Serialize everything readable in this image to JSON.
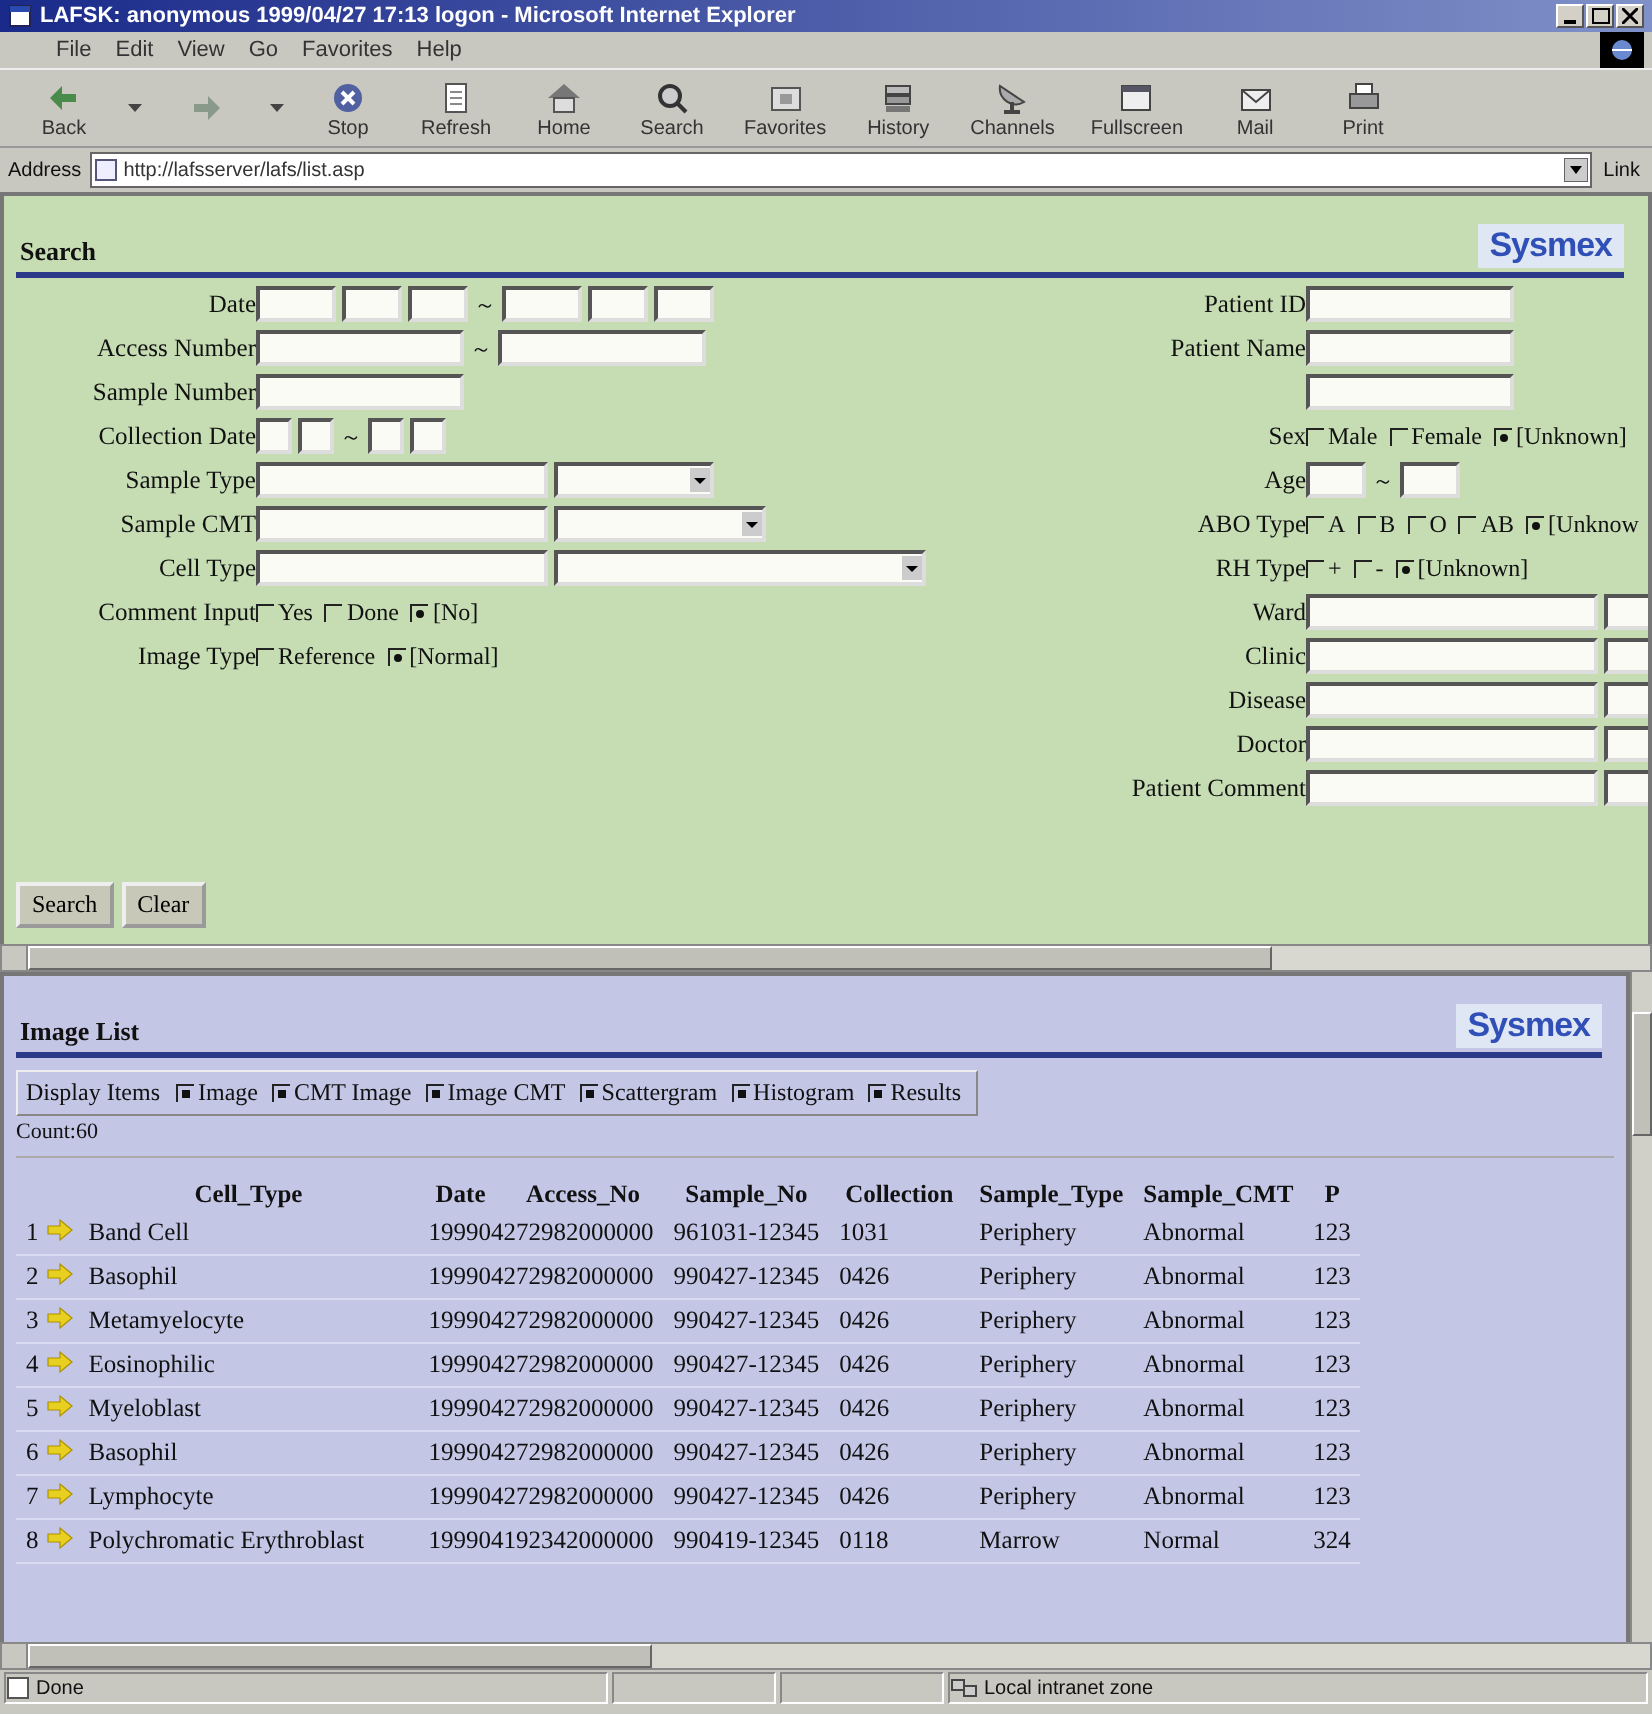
{
  "window": {
    "title": "LAFSK: anonymous 1999/04/27 17:13 logon - Microsoft Internet Explorer"
  },
  "menu": [
    "File",
    "Edit",
    "View",
    "Go",
    "Favorites",
    "Help"
  ],
  "toolbar": [
    {
      "kind": "back",
      "label": "Back"
    },
    {
      "kind": "forward"
    },
    {
      "kind": "stop",
      "label": "Stop"
    },
    {
      "kind": "refresh",
      "label": "Refresh"
    },
    {
      "kind": "home",
      "label": "Home"
    },
    {
      "kind": "search",
      "label": "Search"
    },
    {
      "kind": "favorites",
      "label": "Favorites"
    },
    {
      "kind": "history",
      "label": "History"
    },
    {
      "kind": "channels",
      "label": "Channels"
    },
    {
      "kind": "fullscreen",
      "label": "Fullscreen"
    },
    {
      "kind": "mail",
      "label": "Mail"
    },
    {
      "kind": "print",
      "label": "Print"
    }
  ],
  "address": {
    "label": "Address",
    "value": "http://lafsserver/lafs/list.asp",
    "links": "Link"
  },
  "search": {
    "title": "Search",
    "logo": "Sysmex",
    "left_fields": [
      {
        "kind": "date_range",
        "label": "Date",
        "separator": "～"
      },
      {
        "kind": "text_range",
        "label": "Access Number",
        "separator": "～"
      },
      {
        "kind": "text",
        "label": "Sample Number"
      },
      {
        "kind": "short_range",
        "label": "Collection Date",
        "separator": "～"
      },
      {
        "kind": "text_select",
        "label": "Sample Type"
      },
      {
        "kind": "text_select_wide",
        "label": "Sample CMT"
      },
      {
        "kind": "text_select_long",
        "label": "Cell Type"
      },
      {
        "kind": "options",
        "label": "Comment Input",
        "options": [
          {
            "label": "Yes",
            "selected": false
          },
          {
            "label": "Done",
            "selected": false
          },
          {
            "label": "[No]",
            "selected": true
          }
        ]
      },
      {
        "kind": "options",
        "label": "Image Type",
        "options": [
          {
            "label": "Reference",
            "selected": false
          },
          {
            "label": "[Normal]",
            "selected": true
          }
        ]
      }
    ],
    "right_fields": [
      {
        "kind": "text",
        "label": "Patient ID"
      },
      {
        "kind": "text",
        "label": "Patient Name"
      },
      {
        "kind": "text"
      },
      {
        "kind": "options",
        "label": "Sex",
        "options": [
          {
            "label": "Male",
            "selected": false
          },
          {
            "label": "Female",
            "selected": false
          },
          {
            "label": "[Unknown]",
            "selected": true
          }
        ]
      },
      {
        "kind": "age_range",
        "label": "Age",
        "separator": "～"
      },
      {
        "kind": "options",
        "label": "ABO Type",
        "options": [
          {
            "label": "A",
            "selected": false
          },
          {
            "label": "B",
            "selected": false
          },
          {
            "label": "O",
            "selected": false
          },
          {
            "label": "AB",
            "selected": false
          },
          {
            "label": "[Unknow",
            "selected": true
          }
        ]
      },
      {
        "kind": "options",
        "label": "RH Type",
        "options": [
          {
            "label": "+",
            "selected": false
          },
          {
            "label": "-",
            "selected": false
          },
          {
            "label": "[Unknown]",
            "selected": true
          }
        ]
      },
      {
        "kind": "text_pair",
        "label": "Ward"
      },
      {
        "kind": "text_pair",
        "label": "Clinic"
      },
      {
        "kind": "text_pair",
        "label": "Disease"
      },
      {
        "kind": "text_pair",
        "label": "Doctor"
      },
      {
        "kind": "text_pair",
        "label": "Patient Comment"
      }
    ],
    "buttons": [
      "Search",
      "Clear"
    ]
  },
  "image_list": {
    "title": "Image List",
    "logo": "Sysmex",
    "display_label": "Display Items",
    "display_items": [
      {
        "label": "Image",
        "checked": true
      },
      {
        "label": "CMT Image",
        "checked": true
      },
      {
        "label": "Image CMT",
        "checked": true
      },
      {
        "label": "Scattergram",
        "checked": true
      },
      {
        "label": "Histogram",
        "checked": true
      },
      {
        "label": "Results",
        "checked": true
      }
    ],
    "count": "Count:60",
    "columns": [
      "Cell_Type",
      "Date",
      "Access_No",
      "Sample_No",
      "Collection",
      "Sample_Type",
      "Sample_CMT",
      "P"
    ],
    "rows": [
      {
        "no": "1",
        "cell_type": "Band Cell",
        "date_access": "199904272982000000",
        "sample_no": "961031-12345",
        "collection": "1031",
        "sample_type": "Periphery",
        "sample_cmt": "Abnormal",
        "p": "123"
      },
      {
        "no": "2",
        "cell_type": "Basophil",
        "date_access": "199904272982000000",
        "sample_no": "990427-12345",
        "collection": "0426",
        "sample_type": "Periphery",
        "sample_cmt": "Abnormal",
        "p": "123"
      },
      {
        "no": "3",
        "cell_type": "Metamyelocyte",
        "date_access": "199904272982000000",
        "sample_no": "990427-12345",
        "collection": "0426",
        "sample_type": "Periphery",
        "sample_cmt": "Abnormal",
        "p": "123"
      },
      {
        "no": "4",
        "cell_type": "Eosinophilic",
        "date_access": "199904272982000000",
        "sample_no": "990427-12345",
        "collection": "0426",
        "sample_type": "Periphery",
        "sample_cmt": "Abnormal",
        "p": "123"
      },
      {
        "no": "5",
        "cell_type": "Myeloblast",
        "date_access": "199904272982000000",
        "sample_no": "990427-12345",
        "collection": "0426",
        "sample_type": "Periphery",
        "sample_cmt": "Abnormal",
        "p": "123"
      },
      {
        "no": "6",
        "cell_type": "Basophil",
        "date_access": "199904272982000000",
        "sample_no": "990427-12345",
        "collection": "0426",
        "sample_type": "Periphery",
        "sample_cmt": "Abnormal",
        "p": "123"
      },
      {
        "no": "7",
        "cell_type": "Lymphocyte",
        "date_access": "199904272982000000",
        "sample_no": "990427-12345",
        "collection": "0426",
        "sample_type": "Periphery",
        "sample_cmt": "Abnormal",
        "p": "123"
      },
      {
        "no": "8",
        "cell_type": "Polychromatic Erythroblast",
        "date_access": "199904192342000000",
        "sample_no": "990419-12345",
        "collection": "0118",
        "sample_type": "Marrow",
        "sample_cmt": "Normal",
        "p": "324"
      }
    ]
  },
  "status_bar": {
    "text": "Done",
    "zone": "Local intranet zone"
  }
}
